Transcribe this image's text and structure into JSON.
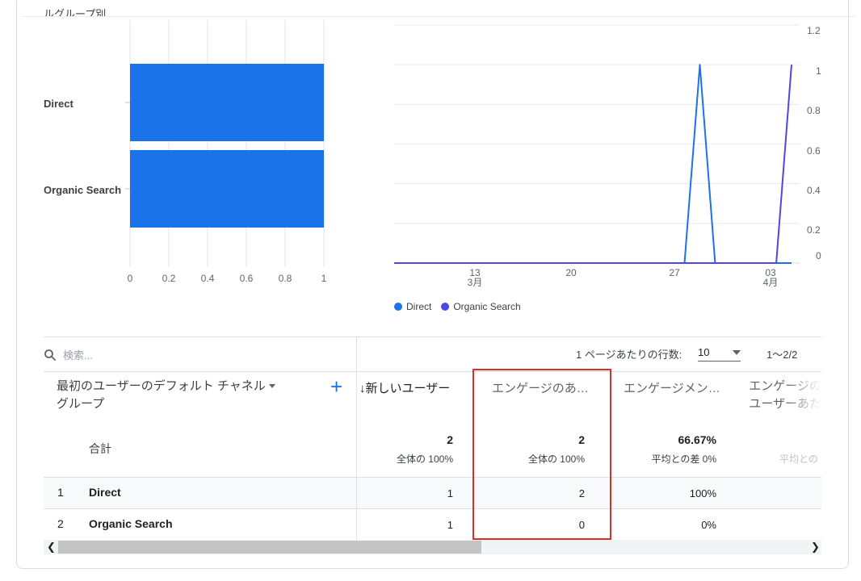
{
  "section": {
    "title_fragment": "ルグループ別"
  },
  "bar_chart": {
    "categories": [
      "Direct",
      "Organic Search"
    ],
    "x_ticks": [
      "0",
      "0.2",
      "0.4",
      "0.6",
      "0.8",
      "1"
    ]
  },
  "line_chart": {
    "y_ticks": [
      "1.2",
      "1",
      "0.8",
      "0.6",
      "0.4",
      "0.2",
      "0"
    ],
    "x_ticks": [
      {
        "day": "13",
        "month": "3月"
      },
      {
        "day": "20",
        "month": ""
      },
      {
        "day": "27",
        "month": ""
      },
      {
        "day": "03",
        "month": "4月"
      }
    ],
    "legend": [
      "Direct",
      "Organic Search"
    ]
  },
  "colors": {
    "direct": "#1a73e8",
    "organic": "#4f46e5",
    "highlight": "#d93025"
  },
  "chart_data": [
    {
      "type": "bar",
      "categories": [
        "Direct",
        "Organic Search"
      ],
      "values": [
        1,
        1
      ],
      "xlim": [
        0,
        1
      ]
    },
    {
      "type": "line",
      "x": [
        "3/9",
        "3/10",
        "3/11",
        "3/12",
        "3/13",
        "3/14",
        "3/15",
        "3/16",
        "3/17",
        "3/18",
        "3/19",
        "3/20",
        "3/21",
        "3/22",
        "3/23",
        "3/24",
        "3/25",
        "3/26",
        "3/27",
        "3/28",
        "3/29",
        "3/30",
        "3/31",
        "4/1",
        "4/2",
        "4/3",
        "4/4"
      ],
      "series": [
        {
          "name": "Direct",
          "values": [
            0,
            0,
            0,
            0,
            0,
            0,
            0,
            0,
            0,
            0,
            0,
            0,
            0,
            0,
            0,
            0,
            0,
            0,
            0,
            0,
            1,
            0,
            0,
            0,
            0,
            0,
            0
          ]
        },
        {
          "name": "Organic Search",
          "values": [
            0,
            0,
            0,
            0,
            0,
            0,
            0,
            0,
            0,
            0,
            0,
            0,
            0,
            0,
            0,
            0,
            0,
            0,
            0,
            0,
            0,
            0,
            0,
            0,
            0,
            0,
            1
          ]
        }
      ],
      "ylim": [
        0,
        1.2
      ]
    }
  ],
  "table": {
    "search_placeholder": "検索...",
    "rows_per_page_label": "1 ページあたりの行数:",
    "rows_per_page_value": "10",
    "range_label": "1～2/2",
    "dimension_header_line1": "最初のユーザーのデフォルト チャネル",
    "dimension_header_line2": "グループ",
    "add_icon": "+",
    "columns": [
      "↓新しいユーザー",
      "エンゲージのあ…",
      "エンゲージメン…",
      "エンゲージの",
      "ユーザーあた"
    ],
    "totals": {
      "label": "合計",
      "new_users": "2",
      "new_users_sub": "全体の 100%",
      "engaged": "2",
      "engaged_sub": "全体の 100%",
      "engagement_rate": "66.67%",
      "engagement_rate_sub": "平均との差 0%",
      "partial_sub": "平均との"
    },
    "rows": [
      {
        "index": "1",
        "name": "Direct",
        "new_users": "1",
        "engaged": "2",
        "rate": "100%"
      },
      {
        "index": "2",
        "name": "Organic Search",
        "new_users": "1",
        "engaged": "0",
        "rate": "0%"
      }
    ]
  }
}
